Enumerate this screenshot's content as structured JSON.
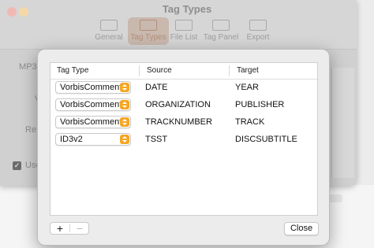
{
  "window": {
    "title": "Tag Types",
    "toolbar": [
      {
        "label": "General",
        "icon": "general-icon",
        "active": false
      },
      {
        "label": "Tag Types",
        "icon": "tag-types-icon",
        "active": true
      },
      {
        "label": "File List",
        "icon": "file-list-icon",
        "active": false
      },
      {
        "label": "Tag Panel",
        "icon": "tag-panel-icon",
        "active": false
      },
      {
        "label": "Export",
        "icon": "export-icon",
        "active": false
      }
    ],
    "partial_labels": {
      "mp3": "MP3",
      "v": "V",
      "re": "Re",
      "use": "Use"
    }
  },
  "sheet": {
    "columns": [
      "Tag Type",
      "Source",
      "Target"
    ],
    "rows": [
      {
        "tag_type": "VorbisComment",
        "source": "DATE",
        "target": "YEAR"
      },
      {
        "tag_type": "VorbisComment",
        "source": "ORGANIZATION",
        "target": "PUBLISHER"
      },
      {
        "tag_type": "VorbisComment",
        "source": "TRACKNUMBER",
        "target": "TRACK"
      },
      {
        "tag_type": "ID3v2",
        "source": "TSST",
        "target": "DISCSUBTITLE"
      }
    ],
    "add_label": "+",
    "remove_label": "−",
    "close_label": "Close"
  },
  "colors": {
    "accent": "#f5a623",
    "active_tab": "#b38f7d"
  }
}
